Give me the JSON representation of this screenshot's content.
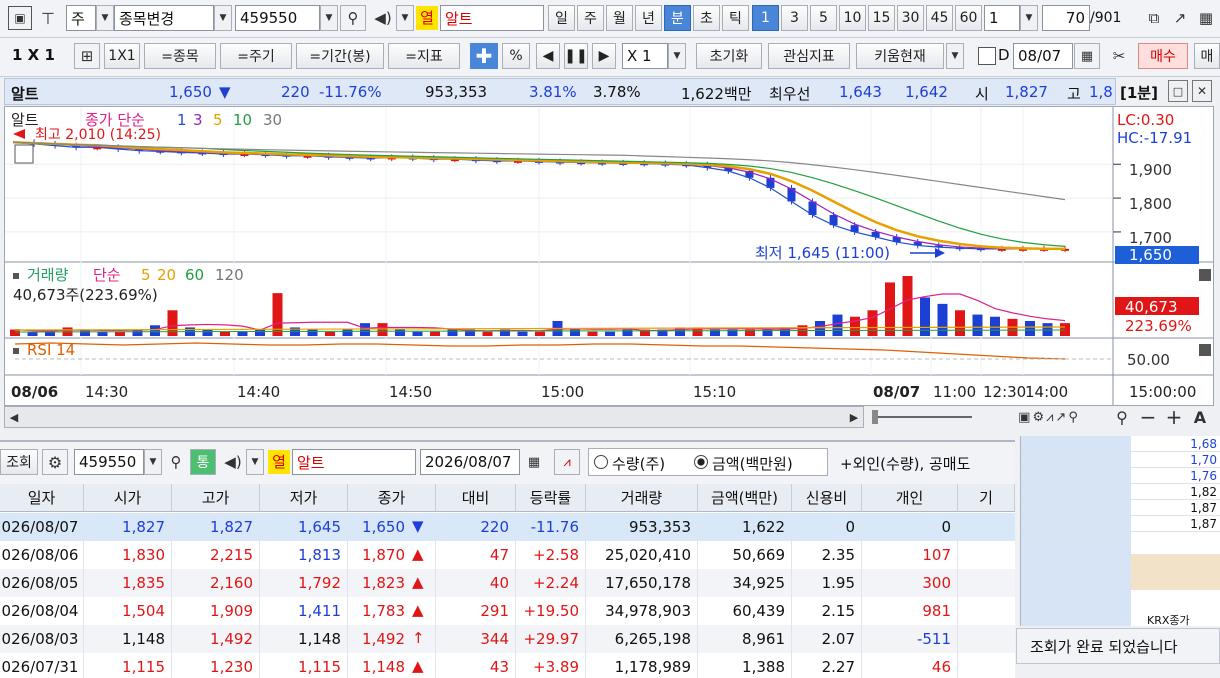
{
  "toolbar1": {
    "market": "주",
    "search_mode": "종목변경",
    "code": "459550",
    "flag": "열",
    "name": "알트",
    "periods": [
      "일",
      "주",
      "월",
      "년",
      "분",
      "초",
      "틱"
    ],
    "active_period": "분",
    "intervals": [
      "1",
      "3",
      "5",
      "10",
      "15",
      "30",
      "45",
      "60"
    ],
    "active_interval": "1",
    "interval_select": "1",
    "page_counter": "70",
    "page_total": "/901"
  },
  "toolbar2": {
    "layout": "1 X 1",
    "layout_btn": "1X1",
    "btn_stock": "=종목",
    "btn_period": "=주기",
    "btn_range": "=기간(봉)",
    "btn_indicator": "=지표",
    "percent": "%",
    "speed": "X 1",
    "reset": "초기화",
    "interest": "관심지표",
    "kiwoom": "키움현재",
    "date_label": "D",
    "date": "08/07",
    "buy": "매수",
    "more": "매"
  },
  "quote": {
    "name": "알트",
    "price": "1,650",
    "arrow": "▼",
    "change": "220",
    "change_rate": "-11.76%",
    "volume": "953,353",
    "rate1": "3.81%",
    "rate2": "3.78%",
    "amount": "1,622백만",
    "best_label": "최우선",
    "ask": "1,643",
    "bid": "1,642",
    "open_label": "시",
    "open": "1,827",
    "high_label": "고",
    "high": "1,8",
    "period_tag": "[1분]"
  },
  "chart_data": [
    {
      "type": "candlestick",
      "title": "알트",
      "legend": [
        "종가 단순",
        "1",
        "3",
        "5",
        "10",
        "30"
      ],
      "annotations": [
        "최고 2,010 (14:25)",
        "최저 1,645 (11:00)",
        "LC:0.30",
        "HC:-17.91"
      ],
      "y_ticks": [
        "1,900",
        "1,800",
        "1,700"
      ],
      "current_value": "1,650",
      "ylim": [
        1620,
        2010
      ],
      "x_ticks": [
        "08/06",
        "14:30",
        "14:40",
        "14:50",
        "15:00",
        "15:10",
        "08/07",
        "11:00",
        "12:30",
        "14:00",
        "15:00:00"
      ],
      "close": [
        1965,
        1960,
        1955,
        1950,
        1950,
        1945,
        1940,
        1938,
        1935,
        1933,
        1930,
        1930,
        1928,
        1925,
        1925,
        1922,
        1920,
        1918,
        1920,
        1918,
        1915,
        1915,
        1912,
        1910,
        1910,
        1908,
        1906,
        1905,
        1904,
        1903,
        1902,
        1900,
        1898,
        1890,
        1880,
        1860,
        1830,
        1790,
        1750,
        1720,
        1700,
        1685,
        1670,
        1660,
        1655,
        1652,
        1650,
        1650,
        1650,
        1650,
        1650
      ]
    },
    {
      "type": "bar",
      "title": "거래량",
      "legend": [
        "단순",
        "5",
        "20",
        "60",
        "120"
      ],
      "summary": "40,673주(223.69%)",
      "current_value": "40,673",
      "current_rate": "223.69%",
      "values": [
        3,
        2,
        2,
        4,
        3,
        2,
        2,
        3,
        5,
        12,
        4,
        3,
        2,
        2,
        3,
        20,
        4,
        3,
        2,
        3,
        6,
        6,
        3,
        2,
        2,
        3,
        3,
        2,
        3,
        2,
        2,
        7,
        3,
        2,
        2,
        3,
        3,
        3,
        4,
        4,
        3,
        3,
        3,
        3,
        4,
        5,
        7,
        10,
        9,
        12,
        25,
        28,
        18,
        15,
        12,
        10,
        9,
        8,
        7,
        6,
        6
      ]
    },
    {
      "type": "line",
      "title": "RSI 14",
      "y_ticks": [
        "50.00"
      ],
      "values": [
        50,
        51,
        50,
        49,
        50,
        51,
        50,
        49,
        49,
        50,
        50,
        49,
        48,
        48,
        49,
        49,
        50,
        50,
        49,
        48,
        48,
        47,
        46,
        45,
        44,
        42,
        40,
        38,
        36,
        35
      ]
    }
  ],
  "scroll": {
    "icons": [
      "zoom-out",
      "zoom-in",
      "minus",
      "plus",
      "A"
    ]
  },
  "toolbar3": {
    "query": "조회",
    "code": "459550",
    "flag": "열",
    "name": "알트",
    "date": "2026/08/07",
    "radio_qty": "수량(주)",
    "radio_amount": "금액(백만원)",
    "extra": "+외인(수량), 공매도"
  },
  "table": {
    "headers": [
      "일자",
      "시가",
      "고가",
      "저가",
      "종가",
      "대비",
      "등락률",
      "거래량",
      "금액(백만)",
      "신용비",
      "개인",
      "기"
    ],
    "rows": [
      [
        "2026/08/07",
        "1,827",
        "1,827",
        "1,645",
        "1,650",
        "▼",
        "220",
        "-11.76",
        "953,353",
        "1,622",
        "0",
        "0"
      ],
      [
        "2026/08/06",
        "1,830",
        "2,215",
        "1,813",
        "1,870",
        "▲",
        "47",
        "+2.58",
        "25,020,410",
        "50,669",
        "2.35",
        "107"
      ],
      [
        "2026/08/05",
        "1,835",
        "2,160",
        "1,792",
        "1,823",
        "▲",
        "40",
        "+2.24",
        "17,650,178",
        "34,925",
        "1.95",
        "300"
      ],
      [
        "2026/08/04",
        "1,504",
        "1,909",
        "1,411",
        "1,783",
        "▲",
        "291",
        "+19.50",
        "34,978,903",
        "60,439",
        "2.15",
        "981"
      ],
      [
        "2026/08/03",
        "1,148",
        "1,492",
        "1,148",
        "1,492",
        "↑",
        "344",
        "+29.97",
        "6,265,198",
        "8,961",
        "2.07",
        "-511"
      ],
      [
        "2026/07/31",
        "1,115",
        "1,230",
        "1,115",
        "1,148",
        "▲",
        "43",
        "+3.89",
        "1,178,989",
        "1,388",
        "2.27",
        "46"
      ]
    ]
  },
  "side_panel": {
    "values": [
      "1,68",
      "1,70",
      "1,76",
      "1,82",
      "1,87",
      "1,87"
    ],
    "krx_label": "KRX종가",
    "status": "조회가 완료 되었습니다"
  },
  "colors": {
    "up": "#e01616",
    "down": "#1c3fd6",
    "active": "#4a86d8",
    "info_bg": "#dfe8f6"
  }
}
